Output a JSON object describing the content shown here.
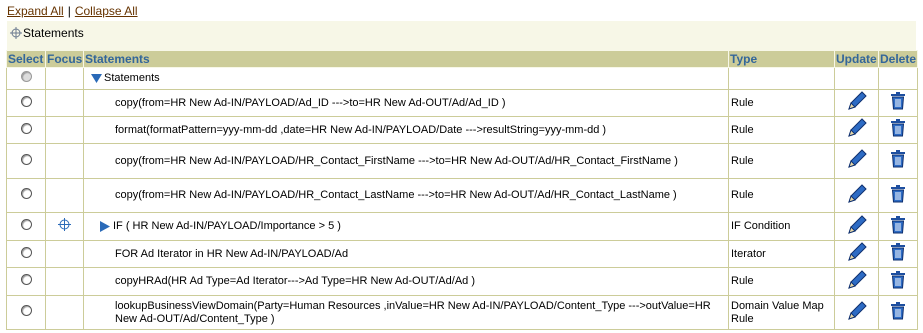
{
  "links": {
    "expand_all": "Expand All",
    "separator": "|",
    "collapse_all": "Collapse All"
  },
  "breadcrumb": {
    "label": "Statements"
  },
  "columns": {
    "select": "Select",
    "focus": "Focus",
    "statements": "Statements",
    "type": "Type",
    "update": "Update",
    "delete": "Delete"
  },
  "root": {
    "label": "Statements"
  },
  "rows": [
    {
      "text": "copy(from=HR New Ad-IN/PAYLOAD/Ad_ID --->to=HR New Ad-OUT/Ad/Ad_ID )",
      "type": "Rule"
    },
    {
      "text": "format(formatPattern=yyy-mm-dd ,date=HR New Ad-IN/PAYLOAD/Date --->resultString=yyy-mm-dd )",
      "type": "Rule"
    },
    {
      "text": "copy(from=HR New Ad-IN/PAYLOAD/HR_Contact_FirstName --->to=HR New Ad-OUT/Ad/HR_Contact_FirstName )",
      "type": "Rule"
    },
    {
      "text": "copy(from=HR New Ad-IN/PAYLOAD/HR_Contact_LastName --->to=HR New Ad-OUT/Ad/HR_Contact_LastName )",
      "type": "Rule"
    },
    {
      "text": "IF ( HR New Ad-IN/PAYLOAD/Importance > 5 )",
      "type": "IF Condition"
    },
    {
      "text": "FOR Ad Iterator in HR New Ad-IN/PAYLOAD/Ad",
      "type": "Iterator"
    },
    {
      "text": "copyHRAd(HR Ad Type=Ad Iterator--->Ad Type=HR New Ad-OUT/Ad/Ad )",
      "type": "Rule"
    },
    {
      "text": "lookupBusinessViewDomain(Party=Human Resources ,inValue=HR New Ad-IN/PAYLOAD/Content_Type --->outValue=HR New Ad-OUT/Ad/Content_Type )",
      "type": "Domain Value Map Rule"
    }
  ],
  "colors": {
    "header_bg": "#cccc99",
    "header_text": "#336699",
    "panel_bg": "#f7f7e7",
    "link": "#663300",
    "icon_blue": "#1f4e9c"
  }
}
